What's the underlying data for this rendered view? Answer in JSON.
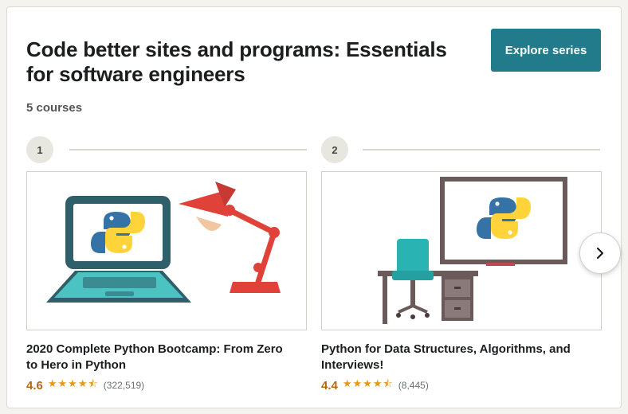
{
  "series": {
    "title": "Code better sites and programs: Essentials for software engineers",
    "course_count": "5 courses",
    "explore_label": "Explore series"
  },
  "courses": [
    {
      "step": "1",
      "title": "2020 Complete Python Bootcamp: From Zero to Hero in Python",
      "rating": "4.6",
      "stars": 4.5,
      "reviews": "(322,519)"
    },
    {
      "step": "2",
      "title": "Python for Data Structures, Algorithms, and Interviews!",
      "rating": "4.4",
      "stars": 4.5,
      "reviews": "(8,445)"
    }
  ],
  "icons": {
    "next": "chevron-right-icon",
    "star": "star-icon"
  },
  "colors": {
    "accent": "#217b8a",
    "rating": "#b4690e",
    "stars": "#e59819"
  }
}
